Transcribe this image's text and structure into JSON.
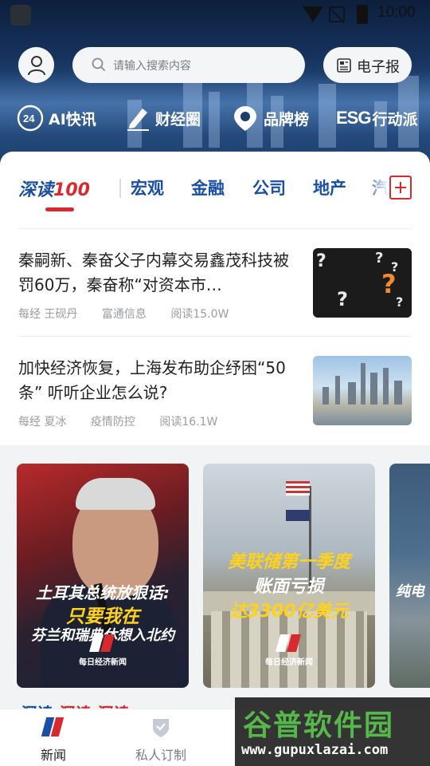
{
  "status_bar": {
    "time": "10:00"
  },
  "header": {
    "search_placeholder": "请输入搜索内容",
    "epaper_label": "电子报"
  },
  "quick_links": [
    {
      "label": "AI快讯",
      "icon": "ai-news-icon"
    },
    {
      "label": "财经圈",
      "icon": "pen-icon"
    },
    {
      "label": "品牌榜",
      "icon": "location-pin-icon"
    },
    {
      "label": "行动派",
      "icon": "esg-icon",
      "prefix": "ESG"
    }
  ],
  "channel_tabs": {
    "feature_prefix": "深读",
    "feature_suffix": "100",
    "items": [
      "宏观",
      "金融",
      "公司",
      "地产",
      "汽"
    ]
  },
  "news": [
    {
      "title": "秦嗣新、秦奋父子内幕交易鑫茂科技被罚60万，秦奋称“对资本市…",
      "author": "每经 王砚丹",
      "tag": "富通信息",
      "reads": "阅读15.0W"
    },
    {
      "title": "加快经济恢复，上海发布助企纾困“50条” 听听企业怎么说?",
      "author": "每经 夏冰",
      "tag": "疫情防控",
      "reads": "阅读16.1W"
    }
  ],
  "video_cards": [
    {
      "line1": "土耳其总统放狠话:",
      "line2": "只要我在",
      "line3": "芬兰和瑞典休想入北约",
      "brand": "每日经济新闻"
    },
    {
      "line1": "美联储第一季度",
      "line2": "账面亏损",
      "line3": "达3300亿美元",
      "brand": "每日经济新闻"
    },
    {
      "line1": "纯电"
    }
  ],
  "bottom_nav": [
    {
      "label": "新闻"
    },
    {
      "label": "私人订制"
    }
  ],
  "watermark": {
    "title": "谷普软件园",
    "url": "www.gupuxlazai.com"
  },
  "colors": {
    "brand_blue": "#1a4fa6",
    "brand_red": "#d8292f"
  }
}
